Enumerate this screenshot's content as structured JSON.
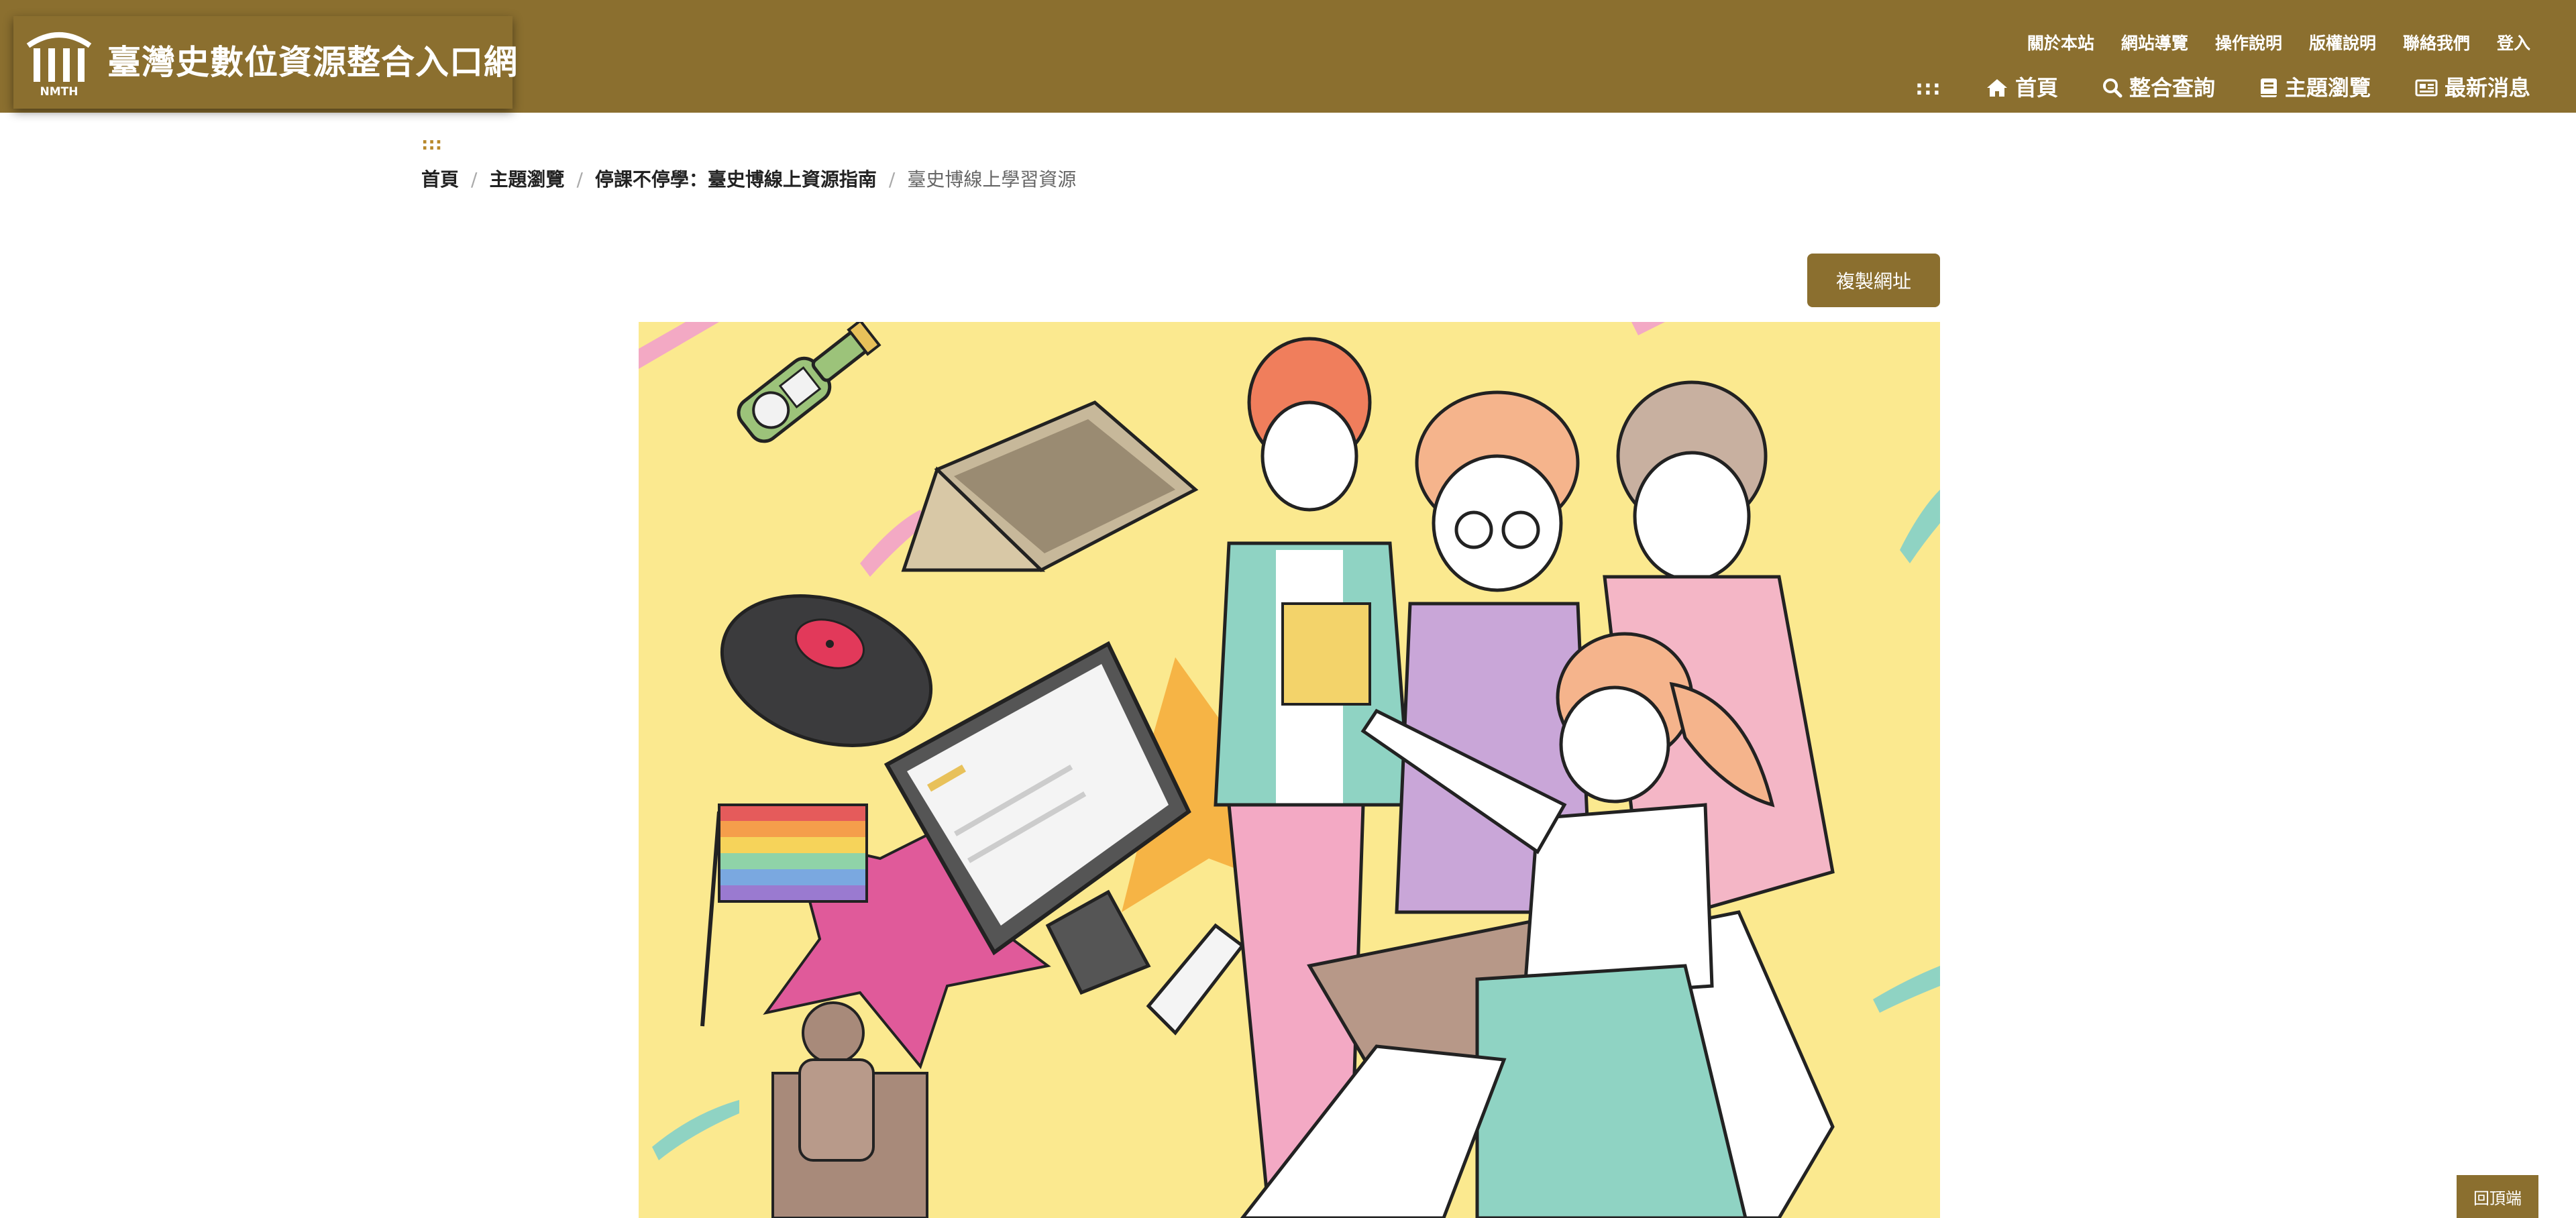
{
  "site": {
    "title": "臺灣史數位資源整合入口網",
    "logo_text": "NMTH"
  },
  "top_links": [
    {
      "label": "關於本站"
    },
    {
      "label": "網站導覽"
    },
    {
      "label": "操作說明"
    },
    {
      "label": "版權說明"
    },
    {
      "label": "聯絡我們"
    },
    {
      "label": "登入"
    }
  ],
  "main_nav": {
    "accesskey": ":::",
    "items": [
      {
        "label": "首頁",
        "icon": "home-icon"
      },
      {
        "label": "整合查詢",
        "icon": "search-icon"
      },
      {
        "label": "主題瀏覽",
        "icon": "book-icon"
      },
      {
        "label": "最新消息",
        "icon": "newspaper-icon"
      }
    ]
  },
  "page": {
    "accesskey": ":::",
    "breadcrumb": [
      {
        "label": "首頁"
      },
      {
        "label": "主題瀏覽"
      },
      {
        "label": "停課不停學：臺史博線上資源指南"
      },
      {
        "label": "臺史博線上學習資源"
      }
    ],
    "copy_button": "複製網址",
    "back_to_top": "回頂端"
  },
  "colors": {
    "brand": "#8b6f2f",
    "hero_background": "#fbe98f",
    "accesskey": "#b8892c"
  }
}
